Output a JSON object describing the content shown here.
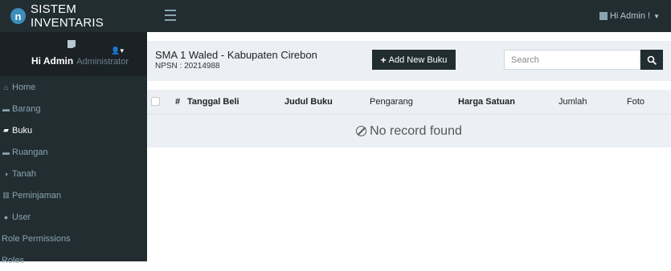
{
  "app": {
    "logo_letter": "n",
    "title": "SISTEM INVENTARIS"
  },
  "topbar": {
    "user_label": "Hi Admin !"
  },
  "sidebar": {
    "user_name": "Hi Admin",
    "user_role": "Administrator",
    "items": [
      {
        "label": "Home",
        "icon": "home-icon"
      },
      {
        "label": "Barang",
        "icon": "car-icon"
      },
      {
        "label": "Buku",
        "icon": "book-icon"
      },
      {
        "label": "Ruangan",
        "icon": "bed-icon"
      },
      {
        "label": "Tanah",
        "icon": "adjust-icon"
      },
      {
        "label": "Peminjaman",
        "icon": "bank-icon"
      },
      {
        "label": "User",
        "icon": "user-icon"
      },
      {
        "label": "Role Permissions",
        "icon": ""
      },
      {
        "label": "Roles",
        "icon": ""
      }
    ]
  },
  "header": {
    "school_name": "SMA 1 Waled - Kabupaten Cirebon",
    "npsn": "NPSN : 20214988",
    "add_button": "Add New Buku",
    "search_placeholder": "Search"
  },
  "table": {
    "columns": [
      "#",
      "Tanggal Beli",
      "Judul Buku",
      "Pengarang",
      "Harga Satuan",
      "Jumlah",
      "Foto"
    ],
    "empty_text": "No record found"
  },
  "colors": {
    "sidebar_bg": "#222d32",
    "panel_bg": "#ecf0f5",
    "accent": "#3c8dbc"
  }
}
